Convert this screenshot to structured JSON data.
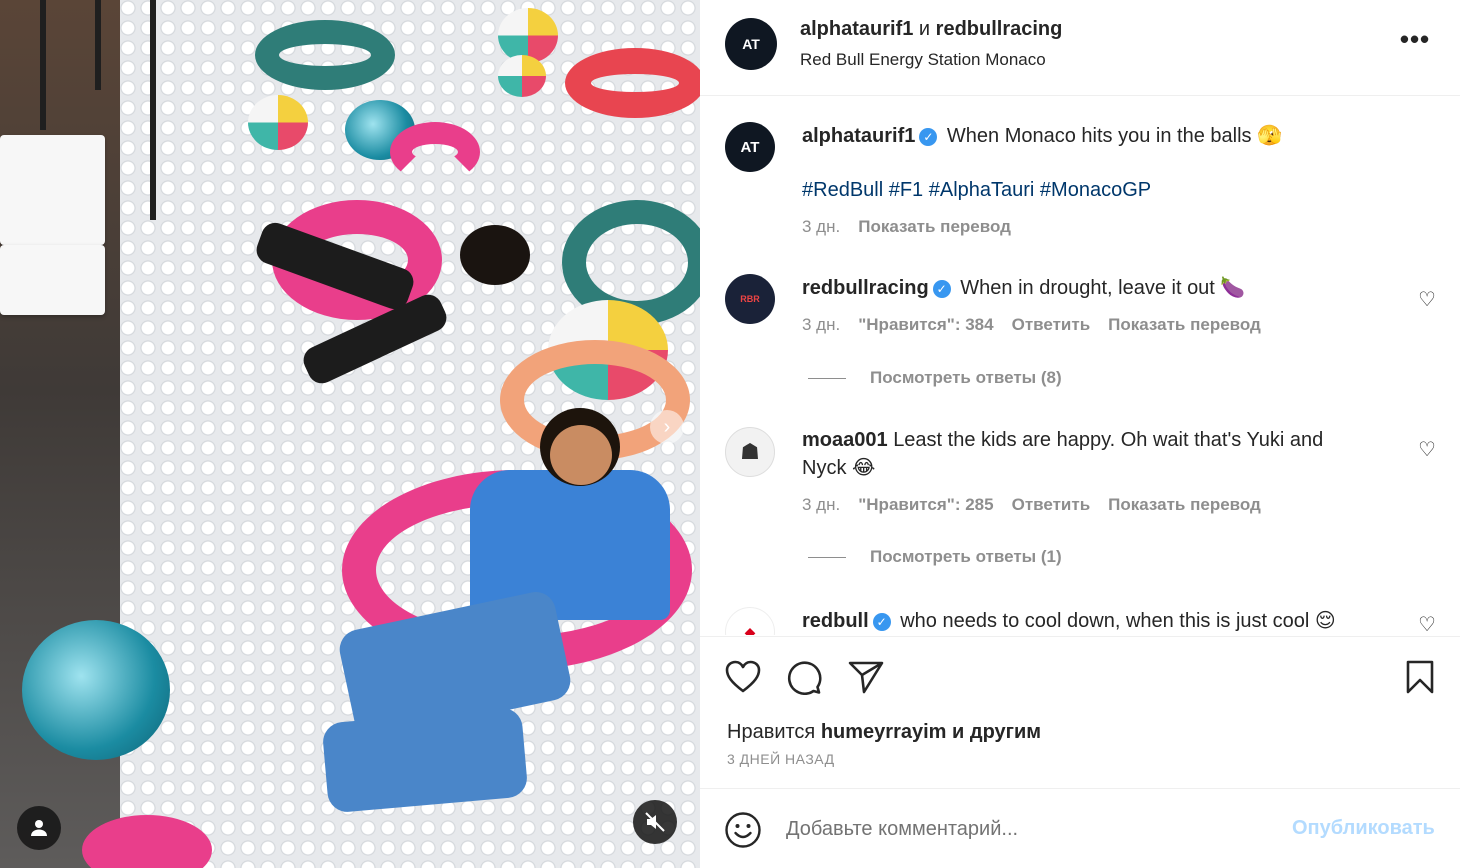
{
  "post": {
    "header": {
      "author": "alphataurif1",
      "conjunction": "и",
      "coauthor": "redbullracing",
      "location": "Red Bull Energy Station Monaco",
      "more_label": "•••"
    },
    "caption": {
      "username": "alphataurif1",
      "text": "When Monaco hits you in the balls 🫣",
      "hashtags": "#RedBull #F1 #AlphaTauri #MonacoGP",
      "age": "3 дн.",
      "translate_label": "Показать перевод"
    },
    "comments": [
      {
        "username": "redbullracing",
        "verified": true,
        "text": "When in drought, leave it out 🍆",
        "age": "3 дн.",
        "likes": "\"Нравится\": 384",
        "reply_label": "Ответить",
        "translate_label": "Показать перевод",
        "view_replies": "Посмотреть ответы (8)"
      },
      {
        "username": "moaa001",
        "verified": false,
        "text": "Least the kids are happy. Oh wait that's Yuki and Nyck 😂",
        "age": "3 дн.",
        "likes": "\"Нравится\": 285",
        "reply_label": "Ответить",
        "translate_label": "Показать перевод",
        "view_replies": "Посмотреть ответы (1)"
      },
      {
        "username": "redbull",
        "verified": true,
        "text": "who needs to cool down, when this is just cool 😌"
      }
    ],
    "likes_prefix": "Нравится",
    "likes_user": "humeyrrayim",
    "likes_suffix": "и другим",
    "date": "3 ДНЕЙ НАЗАД",
    "compose": {
      "placeholder": "Добавьте комментарий...",
      "post_label": "Опубликовать"
    }
  },
  "icons": {
    "like": "heart-icon",
    "comment": "comment-icon",
    "share": "send-icon",
    "save": "bookmark-icon",
    "emoji": "emoji-icon",
    "mute": "muted-speaker-icon",
    "tags": "person-tag-icon",
    "next": "chevron-right-icon"
  },
  "colors": {
    "link": "#00376b",
    "verified": "#3897f0",
    "secondary_text": "#8e8e8e",
    "post_button_disabled": "#b3dbff"
  }
}
